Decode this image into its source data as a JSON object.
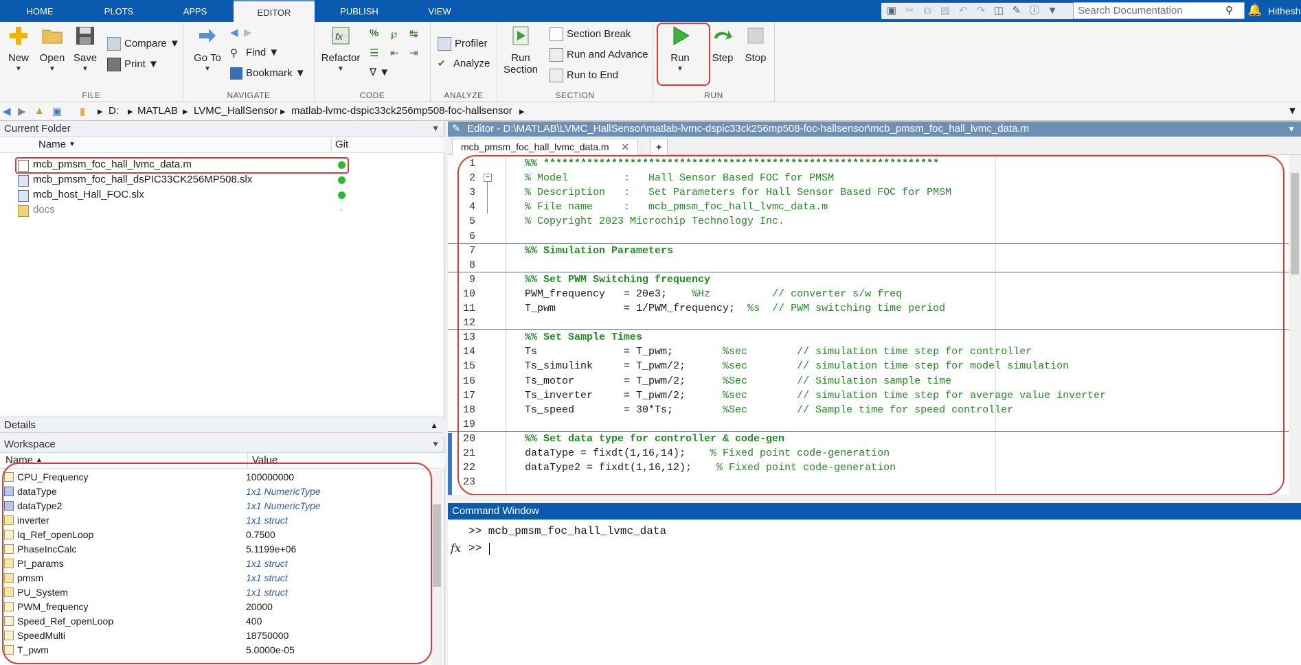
{
  "tabs": [
    "HOME",
    "PLOTS",
    "APPS",
    "EDITOR",
    "PUBLISH",
    "VIEW"
  ],
  "search_placeholder": "Search Documentation",
  "user": "Hithesh",
  "ribbon": {
    "file": {
      "label": "FILE",
      "new": "New",
      "open": "Open",
      "save": "Save",
      "compare": "Compare",
      "print": "Print"
    },
    "navigate": {
      "label": "NAVIGATE",
      "goto": "Go To",
      "find": "Find",
      "bookmark": "Bookmark"
    },
    "code": {
      "label": "CODE",
      "refactor": "Refactor"
    },
    "analyze": {
      "label": "ANALYZE",
      "profiler": "Profiler",
      "analyze": "Analyze"
    },
    "section": {
      "label": "SECTION",
      "run_section_1": "Run",
      "run_section_2": "Section",
      "section_break": "Section Break",
      "run_and_advance": "Run and Advance",
      "run_to_end": "Run to End"
    },
    "run": {
      "label": "RUN",
      "run": "Run",
      "step": "Step",
      "stop": "Stop"
    }
  },
  "breadcrumb": [
    "D:",
    "MATLAB",
    "LVMC_HallSensor",
    "matlab-lvmc-dspic33ck256mp508-foc-hallsensor"
  ],
  "current_folder": {
    "title": "Current Folder",
    "col_name": "Name",
    "col_git": "Git",
    "files": [
      {
        "name": "mcb_pmsm_foc_hall_lvmc_data.m",
        "git": "green"
      },
      {
        "name": "mcb_pmsm_foc_hall_dsPIC33CK256MP508.slx",
        "git": "green"
      },
      {
        "name": "mcb_host_Hall_FOC.slx",
        "git": "green"
      },
      {
        "name": "docs",
        "git": "·"
      }
    ]
  },
  "details_title": "Details",
  "workspace": {
    "title": "Workspace",
    "col_name": "Name",
    "col_value": "Value",
    "vars": [
      {
        "name": "CPU_Frequency",
        "value": "100000000",
        "kind": "num"
      },
      {
        "name": "dataType",
        "value": "1x1 NumericType",
        "kind": "obj"
      },
      {
        "name": "dataType2",
        "value": "1x1 NumericType",
        "kind": "obj"
      },
      {
        "name": "inverter",
        "value": "1x1 struct",
        "kind": "st"
      },
      {
        "name": "Iq_Ref_openLoop",
        "value": "0.7500",
        "kind": "num"
      },
      {
        "name": "PhaseIncCalc",
        "value": "5.1199e+06",
        "kind": "num"
      },
      {
        "name": "PI_params",
        "value": "1x1 struct",
        "kind": "st"
      },
      {
        "name": "pmsm",
        "value": "1x1 struct",
        "kind": "st"
      },
      {
        "name": "PU_System",
        "value": "1x1 struct",
        "kind": "st"
      },
      {
        "name": "PWM_frequency",
        "value": "20000",
        "kind": "num"
      },
      {
        "name": "Speed_Ref_openLoop",
        "value": "400",
        "kind": "num"
      },
      {
        "name": "SpeedMulti",
        "value": "18750000",
        "kind": "num"
      },
      {
        "name": "T_pwm",
        "value": "5.0000e-05",
        "kind": "num"
      }
    ]
  },
  "editor": {
    "title": "Editor - D:\\MATLAB\\LVMC_HallSensor\\matlab-lvmc-dspic33ck256mp508-foc-hallsensor\\mcb_pmsm_foc_hall_lvmc_data.m",
    "tab": "mcb_pmsm_foc_hall_lvmc_data.m",
    "lines": [
      {
        "n": "1",
        "t": "%% ****************************************************************",
        "s": "sec"
      },
      {
        "n": "2",
        "t": "% Model         :   Hall Sensor Based FOC for PMSM",
        "s": "cm"
      },
      {
        "n": "3",
        "t": "% Description   :   Set Parameters for Hall Sensor Based FOC for PMSM",
        "s": "cm"
      },
      {
        "n": "4",
        "t": "% File name     :   mcb_pmsm_foc_hall_lvmc_data.m",
        "s": "cm"
      },
      {
        "n": "5",
        "t": "% Copyright 2023 Microchip Technology Inc.",
        "s": "cm"
      },
      {
        "n": "6",
        "t": "",
        "s": ""
      },
      {
        "n": "7",
        "t": "%% Simulation Parameters",
        "s": "sec"
      },
      {
        "n": "8",
        "t": "",
        "s": ""
      },
      {
        "n": "9",
        "t": "%% Set PWM Switching frequency",
        "s": "sec"
      },
      {
        "n": "10",
        "t": "PWM_frequency   = 20e3;    ",
        "c": "%Hz          // converter s/w freq",
        "s": ""
      },
      {
        "n": "11",
        "t": "T_pwm           = 1/PWM_frequency;  ",
        "c": "%s  // PWM switching time period",
        "s": ""
      },
      {
        "n": "12",
        "t": "",
        "s": ""
      },
      {
        "n": "13",
        "t": "%% Set Sample Times",
        "s": "sec"
      },
      {
        "n": "14",
        "t": "Ts              = T_pwm;        ",
        "c": "%sec        // simulation time step for controller",
        "s": ""
      },
      {
        "n": "15",
        "t": "Ts_simulink     = T_pwm/2;      ",
        "c": "%sec        // simulation time step for model simulation",
        "s": ""
      },
      {
        "n": "16",
        "t": "Ts_motor        = T_pwm/2;      ",
        "c": "%Sec        // Simulation sample time",
        "s": ""
      },
      {
        "n": "17",
        "t": "Ts_inverter     = T_pwm/2;      ",
        "c": "%sec        // simulation time step for average value inverter",
        "s": ""
      },
      {
        "n": "18",
        "t": "Ts_speed        = 30*Ts;        ",
        "c": "%Sec        // Sample time for speed controller",
        "s": ""
      },
      {
        "n": "19",
        "t": "",
        "s": ""
      },
      {
        "n": "20",
        "t": "%% Set data type for controller & code-gen",
        "s": "sec"
      },
      {
        "n": "21",
        "t": "dataType = fixdt(1,16,14);    ",
        "c": "% Fixed point code-generation",
        "s": ""
      },
      {
        "n": "22",
        "t": "dataType2 = fixdt(1,16,12);    ",
        "c": "% Fixed point code-generation",
        "s": ""
      },
      {
        "n": "23",
        "t": "",
        "s": ""
      }
    ]
  },
  "command_window": {
    "title": "Command Window",
    "line1": ">>  mcb_pmsm_foc_hall_lvmc_data",
    "prompt": ">>",
    "fx": "fx"
  }
}
